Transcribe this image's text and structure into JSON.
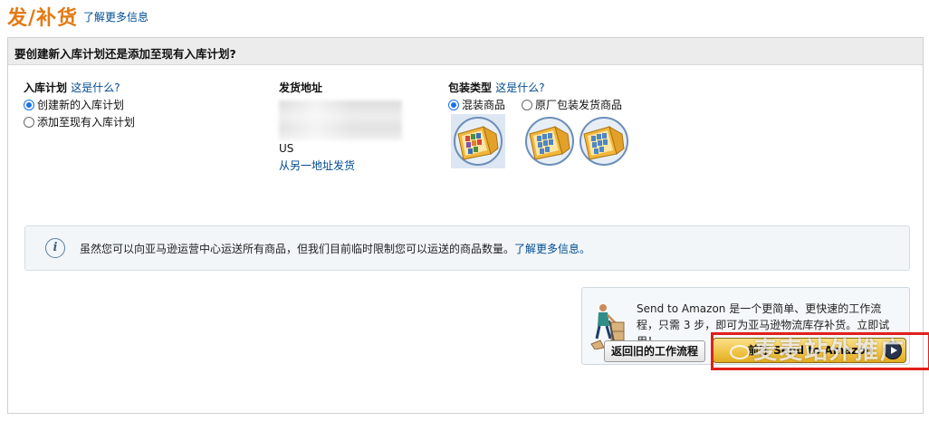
{
  "header": {
    "title": "发/补货",
    "learn_more": "了解更多信息"
  },
  "panel": {
    "question": "要创建新入库计划还是添加至现有入库计划?"
  },
  "plan": {
    "label": "入库计划",
    "help": "这是什么?",
    "options": [
      {
        "label": "创建新的入库计划",
        "selected": true
      },
      {
        "label": "添加至现有入库计划",
        "selected": false
      }
    ]
  },
  "ship_from": {
    "label": "发货地址",
    "country": "US",
    "change_link": "从另一地址发货"
  },
  "packing": {
    "label": "包装类型",
    "help": "这是什么?",
    "options": [
      {
        "label": "混装商品",
        "selected": true
      },
      {
        "label": "原厂包装发货商品",
        "selected": false
      }
    ]
  },
  "notice": {
    "text": "虽然您可以向亚马逊运营中心运送所有商品，但我们目前临时限制您可以运送的商品数量。",
    "link": "了解更多信息。"
  },
  "send_to_amazon": {
    "description": "Send to Amazon 是一个更简单、更快速的工作流程，只需 3 步，即可为亚马逊物流库存补货。立即试用！"
  },
  "buttons": {
    "old_workflow": "返回旧的工作流程",
    "start_sta": "前往 Send to Amazon"
  },
  "watermark": "麦麦站外推广",
  "colors": {
    "title_orange": "#e47911",
    "link_blue": "#004b91",
    "highlight_red": "#e0201b",
    "button_gold": "#f0c44a"
  }
}
